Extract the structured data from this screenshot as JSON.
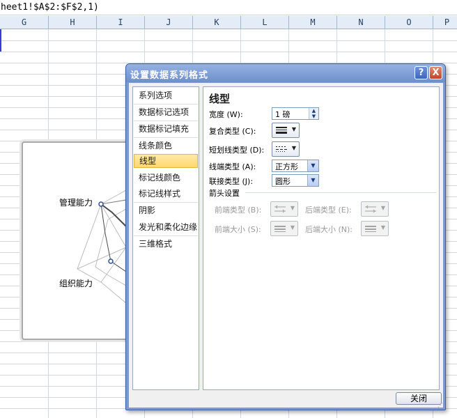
{
  "formula_bar": {
    "text": "heet1!$A$2:$F$2,1)"
  },
  "columns": [
    "G",
    "H",
    "I",
    "J",
    "K",
    "L",
    "M",
    "N",
    "O",
    "P"
  ],
  "chart": {
    "labels": [
      "管理能力",
      "组织能力"
    ]
  },
  "dialog": {
    "title": "设置数据系列格式",
    "help": "?",
    "close": "X",
    "nav": [
      "系列选项",
      "数据标记选项",
      "数据标记填充",
      "线条颜色",
      "线型",
      "标记线颜色",
      "标记线样式",
      "阴影",
      "发光和柔化边缘",
      "三维格式"
    ],
    "active_nav": "线型",
    "panel": {
      "title": "线型",
      "width_label": "宽度 (W):",
      "width_value": "1 磅",
      "compound_label": "复合类型 (C):",
      "dash_label": "短划线类型 (D):",
      "cap_label": "线端类型 (A):",
      "cap_value": "正方形",
      "join_label": "联接类型 (J):",
      "join_value": "圆形",
      "arrow_section": "箭头设置",
      "begin_type_label": "前端类型 (B):",
      "end_type_label": "后端类型 (E):",
      "begin_size_label": "前端大小 (S):",
      "end_size_label": "后端大小 (N):"
    },
    "close_button": "关闭"
  }
}
